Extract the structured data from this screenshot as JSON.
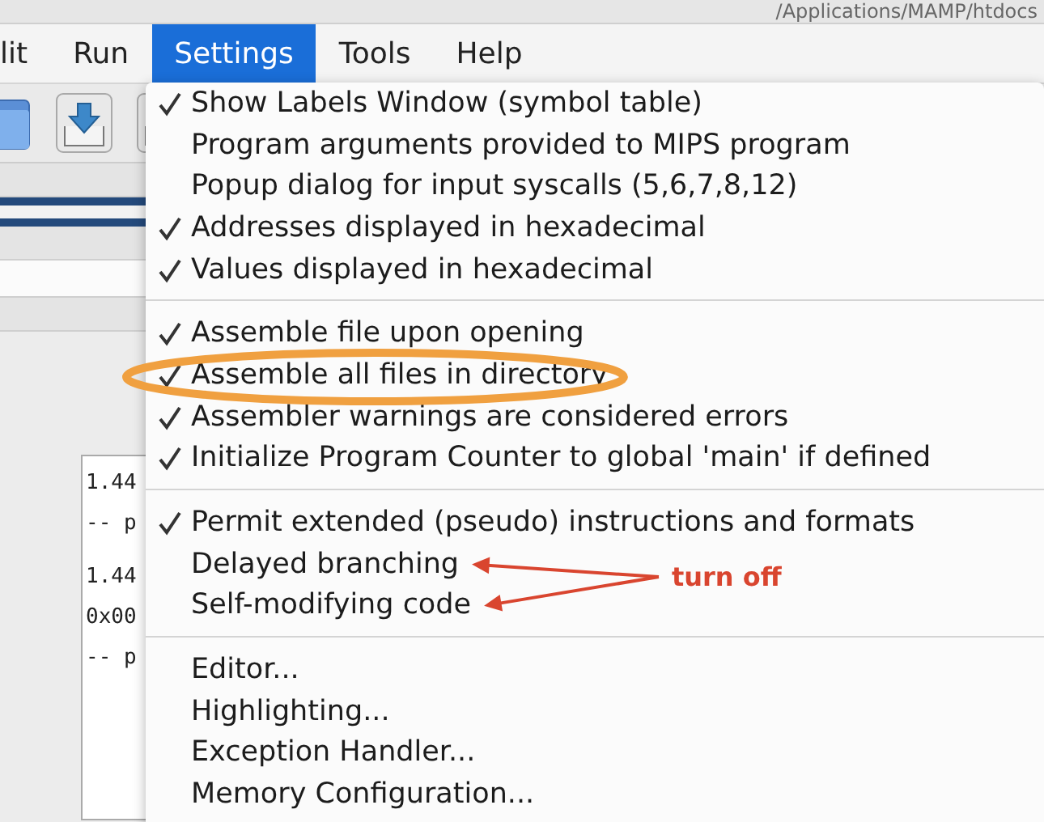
{
  "window": {
    "title": "/Applications/MAMP/htdocs"
  },
  "menubar": [
    {
      "label": "lit",
      "selected": false
    },
    {
      "label": "Run",
      "selected": false
    },
    {
      "label": "Settings",
      "selected": true
    },
    {
      "label": "Tools",
      "selected": false
    },
    {
      "label": "Help",
      "selected": false
    }
  ],
  "console": {
    "blocks": [
      [
        "1.44",
        "-- p"
      ],
      [
        "1.44",
        "0x00",
        "-- p"
      ]
    ]
  },
  "menu": {
    "groups": [
      {
        "items": [
          {
            "label": "Show Labels Window (symbol table)",
            "checked": true,
            "circled": false,
            "pointed": false
          },
          {
            "label": "Program arguments provided to MIPS program",
            "checked": false,
            "circled": false,
            "pointed": false
          },
          {
            "label": "Popup dialog for input syscalls (5,6,7,8,12)",
            "checked": false,
            "circled": false,
            "pointed": false
          },
          {
            "label": "Addresses displayed in hexadecimal",
            "checked": true,
            "circled": false,
            "pointed": false
          },
          {
            "label": "Values displayed in hexadecimal",
            "checked": true,
            "circled": false,
            "pointed": false
          }
        ]
      },
      {
        "items": [
          {
            "label": "Assemble file upon opening",
            "checked": true,
            "circled": false,
            "pointed": false
          },
          {
            "label": "Assemble all files in directory",
            "checked": true,
            "circled": true,
            "pointed": false
          },
          {
            "label": "Assembler warnings are considered errors",
            "checked": true,
            "circled": false,
            "pointed": false
          },
          {
            "label": "Initialize Program Counter to global 'main' if defined",
            "checked": true,
            "circled": false,
            "pointed": false
          }
        ]
      },
      {
        "items": [
          {
            "label": "Permit extended (pseudo) instructions and formats",
            "checked": true,
            "circled": false,
            "pointed": false
          },
          {
            "label": "Delayed branching",
            "checked": false,
            "circled": false,
            "pointed": true
          },
          {
            "label": "Self-modifying code",
            "checked": false,
            "circled": false,
            "pointed": true
          }
        ]
      },
      {
        "items": [
          {
            "label": "Editor...",
            "checked": false,
            "circled": false,
            "pointed": false
          },
          {
            "label": "Highlighting...",
            "checked": false,
            "circled": false,
            "pointed": false
          },
          {
            "label": "Exception Handler...",
            "checked": false,
            "circled": false,
            "pointed": false
          },
          {
            "label": "Memory Configuration...",
            "checked": false,
            "circled": false,
            "pointed": false
          }
        ]
      }
    ]
  },
  "annotation": {
    "note": "turn off"
  }
}
